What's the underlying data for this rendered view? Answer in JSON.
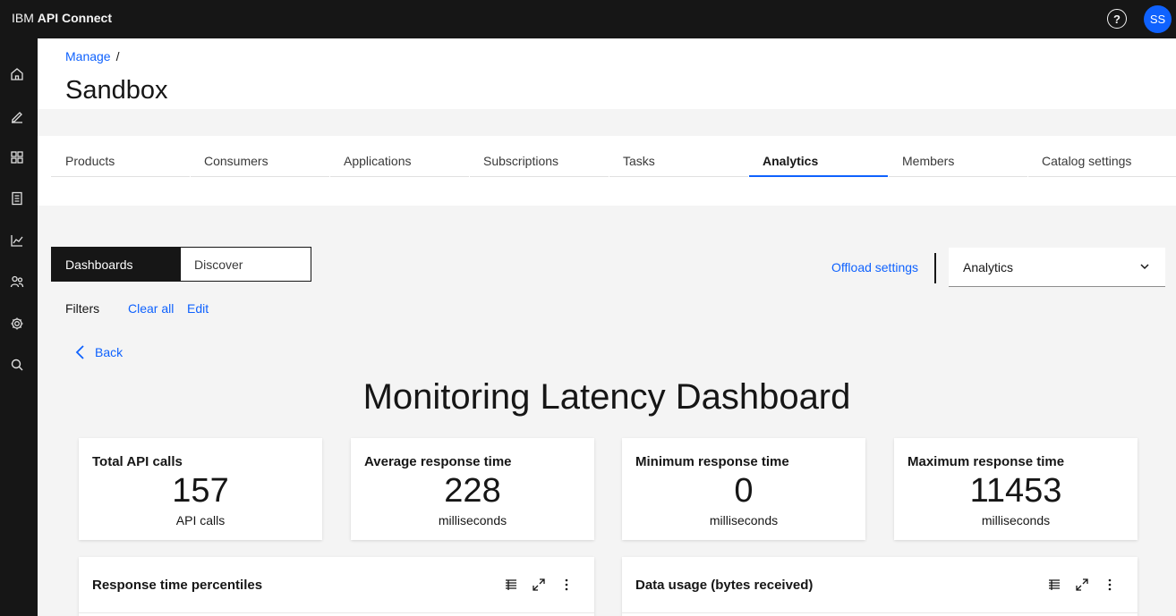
{
  "app": {
    "brand_prefix": "IBM",
    "brand_name": "API Connect",
    "avatar_initials": "SS"
  },
  "sidenav": {
    "items": [
      {
        "icon": "home-icon"
      },
      {
        "icon": "edit-icon"
      },
      {
        "icon": "grid-icon"
      },
      {
        "icon": "document-icon"
      },
      {
        "icon": "analytics-icon"
      },
      {
        "icon": "users-icon"
      },
      {
        "icon": "settings-icon"
      },
      {
        "icon": "search-icon"
      }
    ]
  },
  "breadcrumb": {
    "parent": "Manage",
    "separator": "/"
  },
  "page": {
    "title": "Sandbox"
  },
  "tabs": [
    {
      "label": "Products"
    },
    {
      "label": "Consumers"
    },
    {
      "label": "Applications"
    },
    {
      "label": "Subscriptions"
    },
    {
      "label": "Tasks"
    },
    {
      "label": "Analytics",
      "active": true
    },
    {
      "label": "Members"
    },
    {
      "label": "Catalog settings"
    }
  ],
  "view_switcher": {
    "dashboards": "Dashboards",
    "discover": "Discover"
  },
  "offload_settings": "Offload settings",
  "service_dropdown": {
    "value": "Analytics"
  },
  "filters": {
    "label": "Filters",
    "clear_all": "Clear all",
    "edit": "Edit"
  },
  "back": "Back",
  "dashboard": {
    "title": "Monitoring Latency Dashboard",
    "cards": [
      {
        "title": "Total API calls",
        "value": "157",
        "unit": "API calls"
      },
      {
        "title": "Average response time",
        "value": "228",
        "unit": "milliseconds"
      },
      {
        "title": "Minimum response time",
        "value": "0",
        "unit": "milliseconds"
      },
      {
        "title": "Maximum response time",
        "value": "11453",
        "unit": "milliseconds"
      }
    ],
    "panels": [
      {
        "title": "Response time percentiles"
      },
      {
        "title": "Data usage (bytes received)"
      }
    ]
  },
  "colors": {
    "accent": "#0f62fe",
    "shell": "#161616"
  }
}
